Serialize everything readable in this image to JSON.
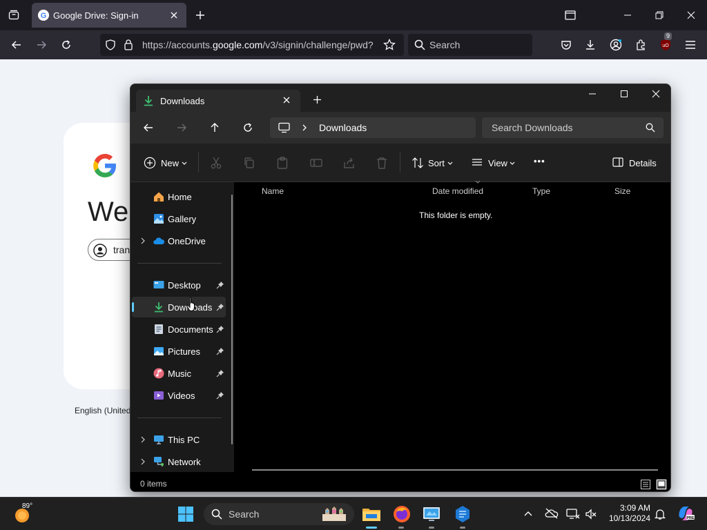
{
  "browser": {
    "tab_title": "Google Drive: Sign-in",
    "url_prefix": "https://accounts.",
    "url_domain": "google.com",
    "url_suffix": "/v3/signin/challenge/pwd?",
    "search_placeholder": "Search",
    "extension_badge": "9"
  },
  "page": {
    "logo_letter": "G",
    "welcome_partial": "Wel",
    "account_partial": "tran",
    "language_partial": "English (United"
  },
  "explorer": {
    "tab_title": "Downloads",
    "breadcrumb": "Downloads",
    "search_placeholder": "Search Downloads",
    "toolbar": {
      "new_label": "New",
      "sort_label": "Sort",
      "view_label": "View",
      "more_label": "•••",
      "details_label": "Details"
    },
    "nav": {
      "home": "Home",
      "gallery": "Gallery",
      "onedrive": "OneDrive",
      "desktop": "Desktop",
      "downloads": "Downloads",
      "documents": "Documents",
      "pictures": "Pictures",
      "music": "Music",
      "videos": "Videos",
      "thispc": "This PC",
      "network": "Network"
    },
    "columns": [
      "Name",
      "Date modified",
      "Type",
      "Size"
    ],
    "empty_message": "This folder is empty.",
    "status": "0 items"
  },
  "taskbar": {
    "weather_temp": "89°",
    "search_placeholder": "Search",
    "time": "3:09 AM",
    "date": "10/13/2024"
  },
  "colors": {
    "accent": "#60cdff",
    "download_green": "#3dbf6e",
    "firefox_tab": "#42414d"
  }
}
